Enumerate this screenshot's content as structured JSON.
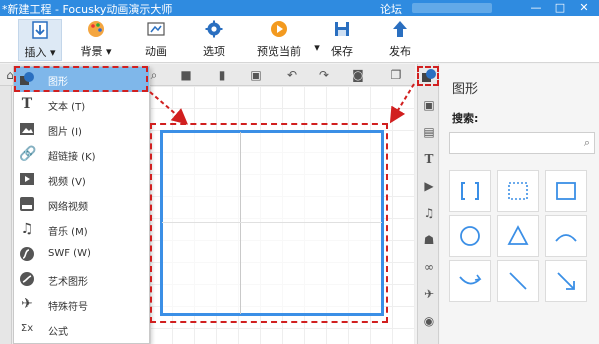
{
  "titlebar": {
    "title": "*新建工程 - Focusky动画演示大师",
    "forum": "论坛",
    "minimize": "—",
    "maximize": "□",
    "close": "✕"
  },
  "ribbon": {
    "insert": "插入",
    "background": "背景",
    "animation": "动画",
    "options": "选项",
    "preview": "预览当前",
    "save": "保存",
    "publish": "发布"
  },
  "menu": {
    "items": [
      {
        "label": "图形",
        "icon": "shapes-icon"
      },
      {
        "label": "文本 (T)",
        "icon": "text-icon"
      },
      {
        "label": "图片 (I)",
        "icon": "image-icon"
      },
      {
        "label": "超链接 (K)",
        "icon": "link-icon"
      },
      {
        "label": "视频 (V)",
        "icon": "video-icon"
      },
      {
        "label": "网络视频",
        "icon": "youtube-icon"
      },
      {
        "label": "音乐 (M)",
        "icon": "music-icon"
      },
      {
        "label": "SWF (W)",
        "icon": "swf-icon"
      },
      {
        "label": "艺术图形",
        "icon": "art-icon"
      },
      {
        "label": "特殊符号",
        "icon": "plane-icon"
      },
      {
        "label": "公式",
        "icon": "formula-icon"
      }
    ]
  },
  "panel": {
    "title": "图形",
    "search_label": "搜索:",
    "search_value": "",
    "search_placeholder": ""
  },
  "colors": {
    "titlebar": "#2f8be0",
    "accent": "#3b8fe6",
    "selected": "#7fb7ea",
    "callout": "#d11f1f"
  }
}
